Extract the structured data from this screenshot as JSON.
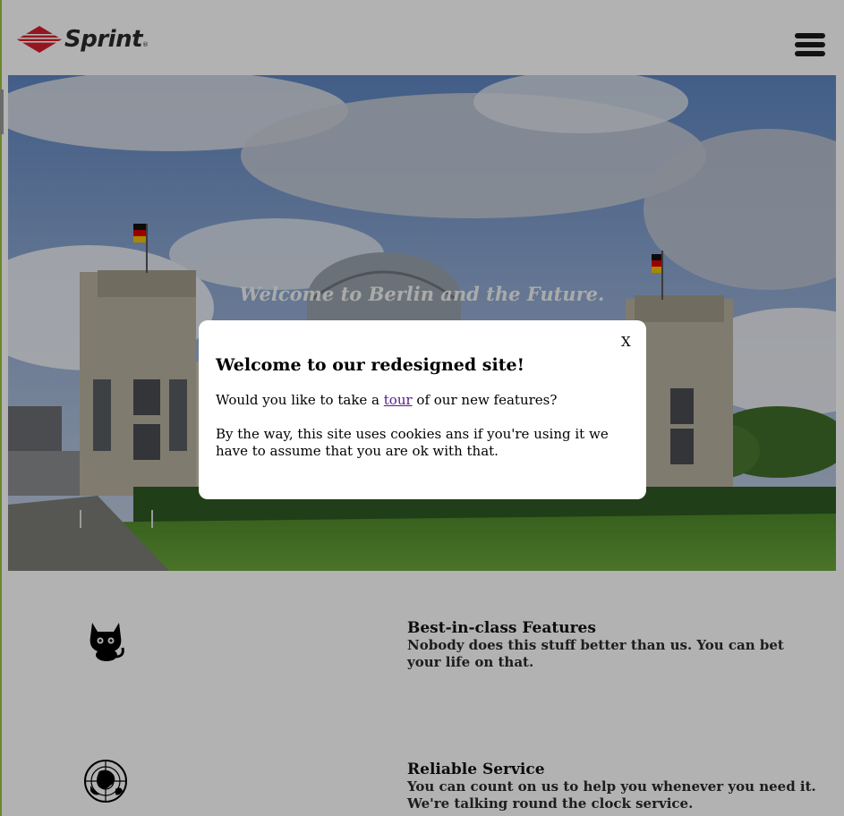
{
  "header": {
    "logo_text": "Sprint",
    "logo_reg": "®",
    "menu_icon": "hamburger-menu-icon"
  },
  "hero": {
    "title": "Welcome to Berlin and the Future."
  },
  "features": [
    {
      "icon": "cat-icon",
      "title": "Best-in-class Features",
      "description": "Nobody does this stuff better than us. You can bet your life on that."
    },
    {
      "icon": "globe-icon",
      "title": "Reliable Service",
      "description": "You can count on us to help you whenever you need it. We're talking round the clock service."
    }
  ],
  "modal": {
    "close_label": "X",
    "title": "Welcome to our redesigned site!",
    "tour_prefix": "Would you like to take a ",
    "tour_link": "tour",
    "tour_suffix": " of our new features?",
    "cookie_text": "By the way, this site uses cookies ans if you're using it we have to assume that you are ok with that."
  },
  "colors": {
    "logo_red": "#d62030",
    "link_visited": "#551a8b",
    "left_edge": "#9bc23c"
  }
}
